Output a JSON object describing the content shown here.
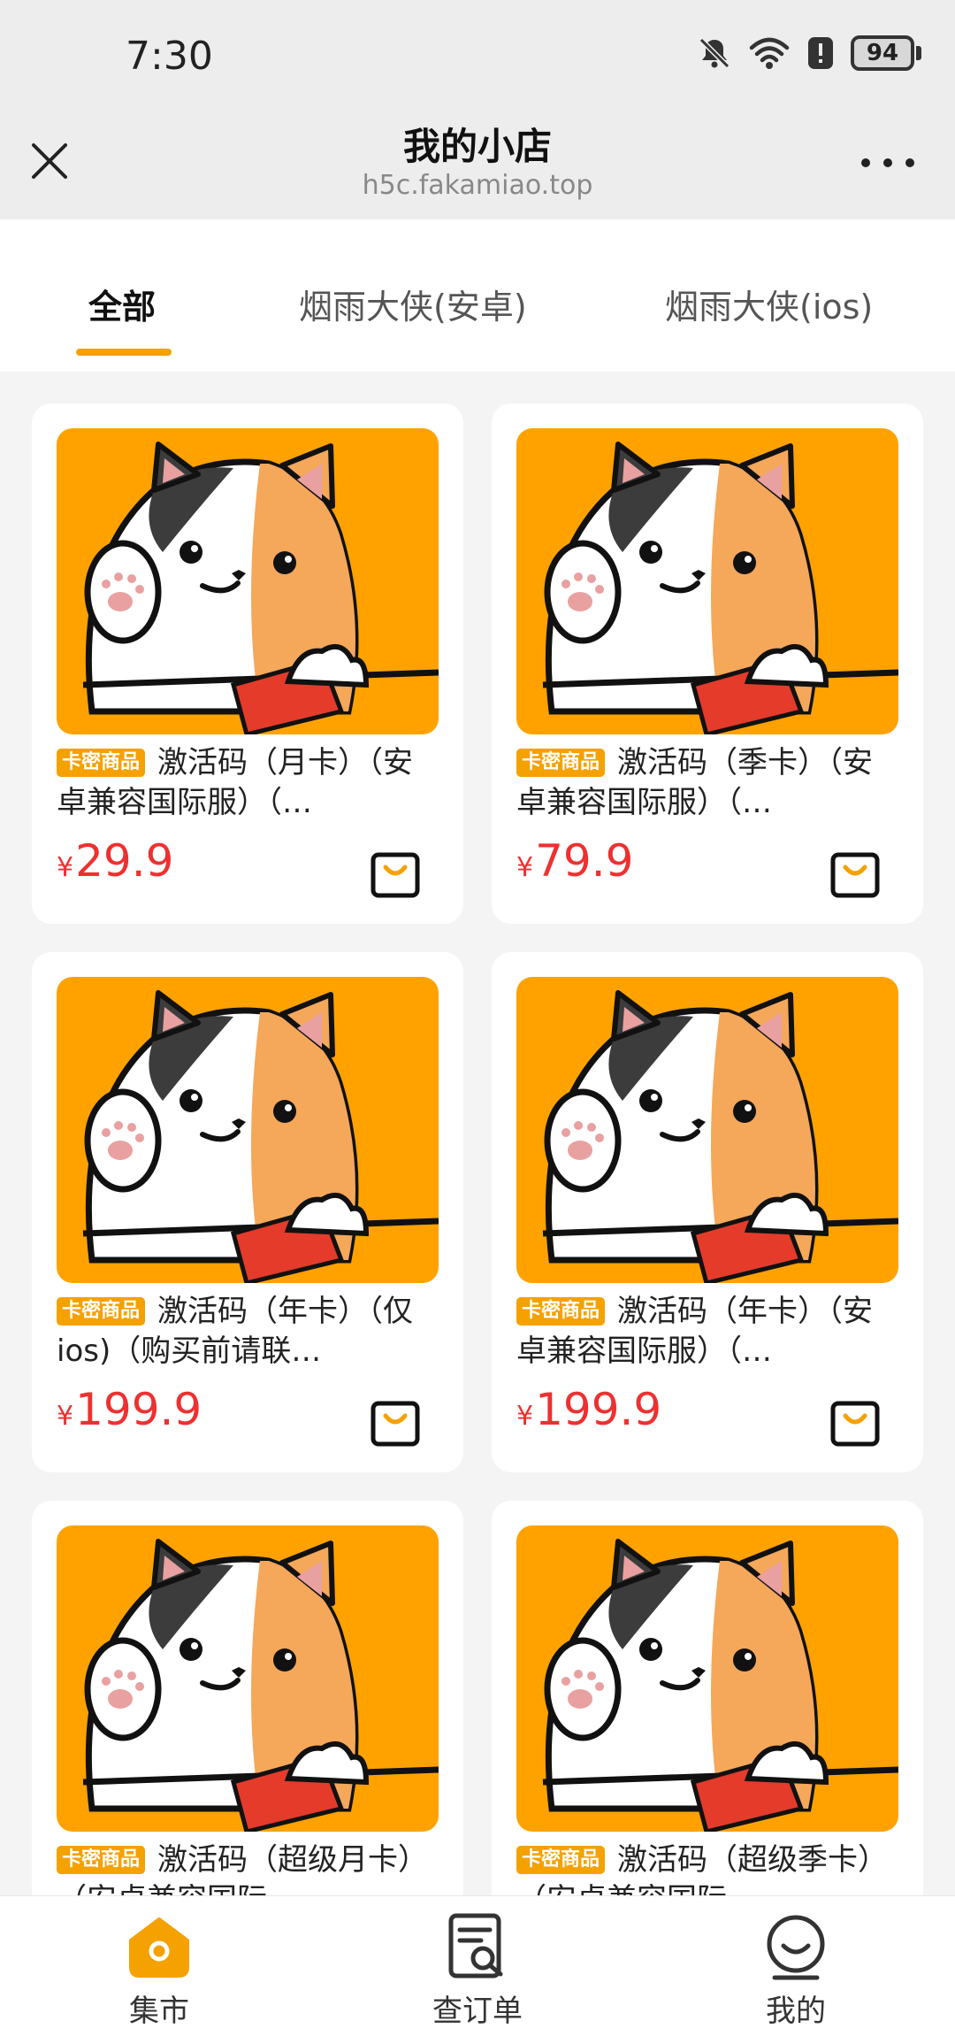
{
  "status_bar": {
    "time": "7:30",
    "battery": "94"
  },
  "header": {
    "title": "我的小店",
    "url": "h5c.fakamiao.top"
  },
  "tabs": [
    {
      "label": "全部",
      "active": true
    },
    {
      "label": "烟雨大侠(安卓)",
      "active": false
    },
    {
      "label": "烟雨大侠(ios)",
      "active": false
    }
  ],
  "products": [
    {
      "badge": "卡密商品",
      "title": "激活码（月卡）（安卓兼容国际服）（…",
      "currency": "¥",
      "price": "29.9"
    },
    {
      "badge": "卡密商品",
      "title": "激活码（季卡）（安卓兼容国际服）（…",
      "currency": "¥",
      "price": "79.9"
    },
    {
      "badge": "卡密商品",
      "title": "激活码（年卡）（仅ios)（购买前请联…",
      "currency": "¥",
      "price": "199.9"
    },
    {
      "badge": "卡密商品",
      "title": "激活码（年卡）（安卓兼容国际服）（…",
      "currency": "¥",
      "price": "199.9"
    },
    {
      "badge": "卡密商品",
      "title": "激活码（超级月卡）（安卓兼容国际",
      "currency": "¥",
      "price": ""
    },
    {
      "badge": "卡密商品",
      "title": "激活码（超级季卡）（安卓兼容国际",
      "currency": "¥",
      "price": ""
    }
  ],
  "bottom_nav": [
    {
      "label": "集市",
      "icon": "home-icon",
      "active": true
    },
    {
      "label": "查订单",
      "icon": "order-search-icon",
      "active": false
    },
    {
      "label": "我的",
      "icon": "profile-icon",
      "active": false
    }
  ],
  "colors": {
    "accent": "#f5a100",
    "price": "#ee3030",
    "product_bg": "#ffa200"
  }
}
